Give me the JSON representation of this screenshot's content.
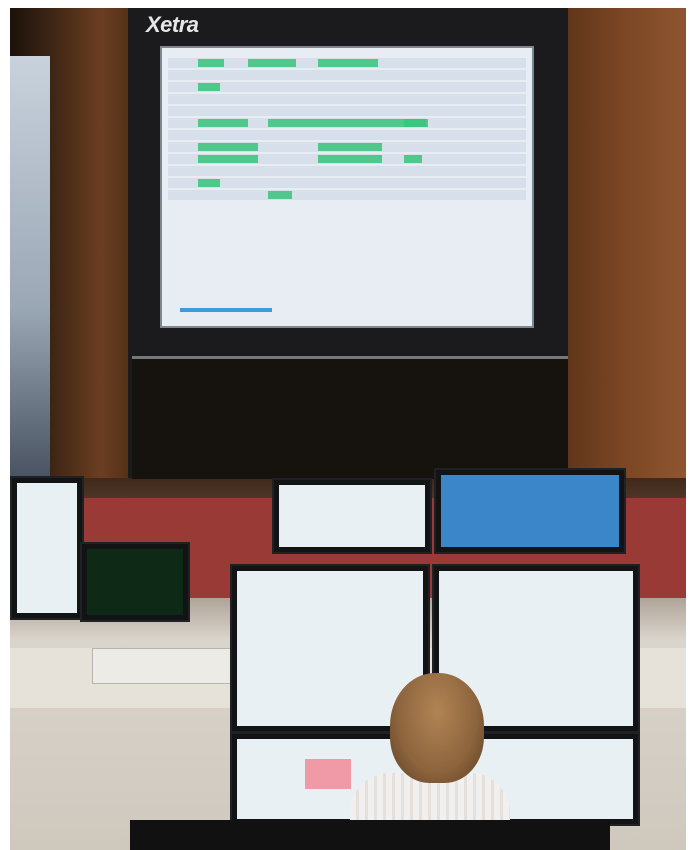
{
  "photo": {
    "brand_text": "Xetra",
    "colors": {
      "wood": "#6b3e21",
      "screen_bg": "#e7edf3",
      "screen_highlight": "#37c47a",
      "console": "#9a3a36"
    }
  }
}
